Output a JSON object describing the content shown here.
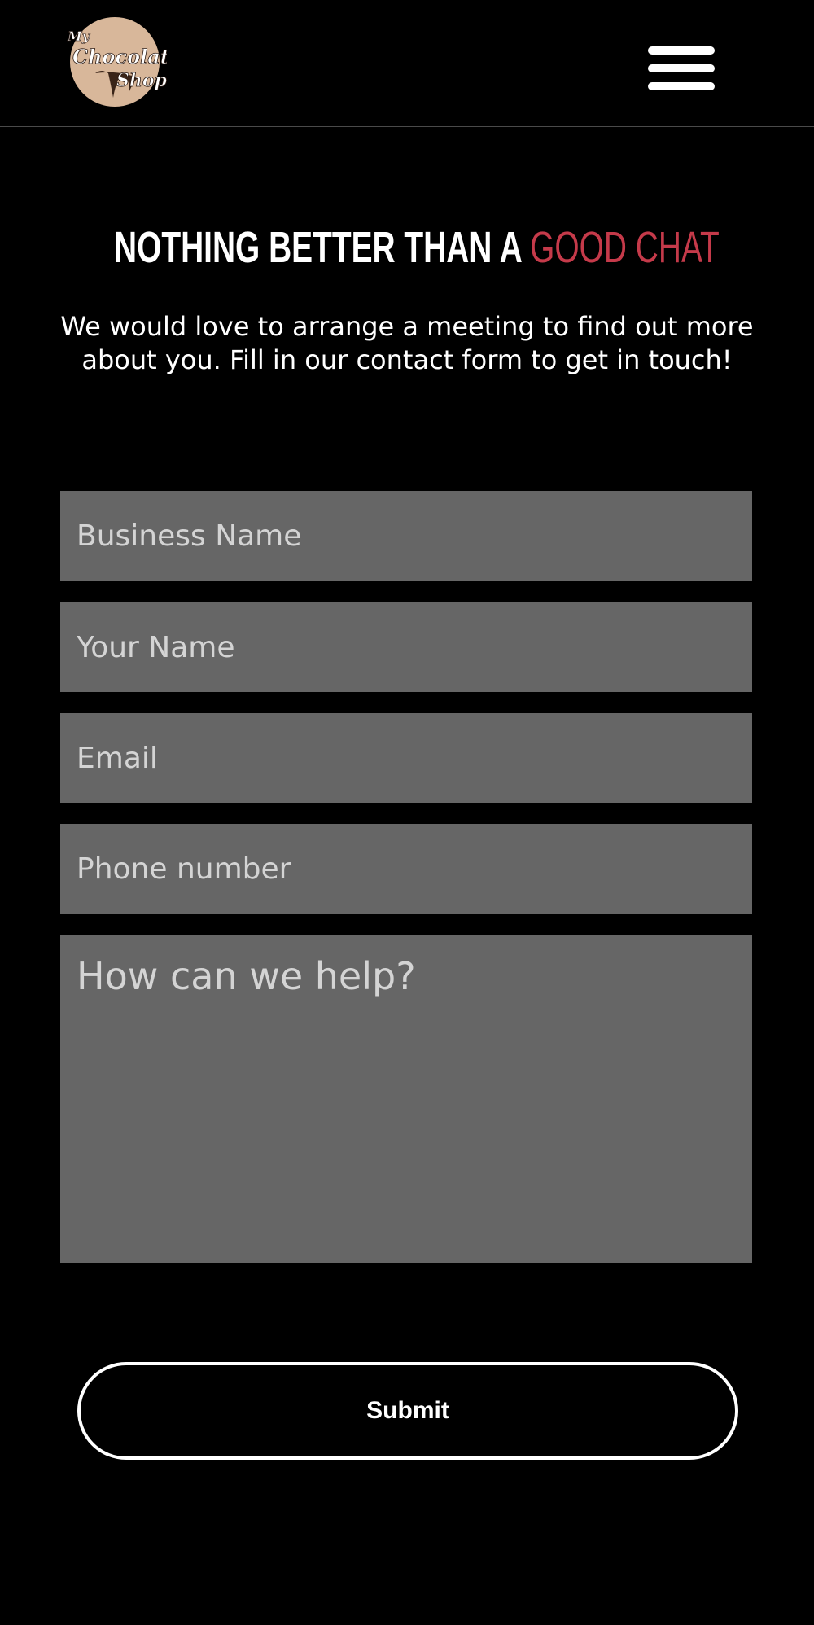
{
  "header": {
    "logo": {
      "line1": "My",
      "line2": "Chocolate",
      "line3": "Shop",
      "bg_color": "#d8b79a",
      "icon": "chocolate-shop-logo"
    },
    "menu_icon": "hamburger-menu-icon"
  },
  "hero": {
    "title_main": "NOTHING BETTER THAN A ",
    "title_accent": "GOOD CHAT",
    "accent_color": "#c53a4a",
    "intro": "We would love to arrange a meeting to find out more about you. Fill in our contact form to get in touch!"
  },
  "form": {
    "business_name": {
      "placeholder": "Business Name",
      "value": ""
    },
    "your_name": {
      "placeholder": "Your Name",
      "value": ""
    },
    "email": {
      "placeholder": "Email",
      "value": ""
    },
    "phone": {
      "placeholder": "Phone number",
      "value": ""
    },
    "message": {
      "placeholder": "How can we help?",
      "value": ""
    },
    "submit_label": "Submit",
    "field_bg": "#666666"
  }
}
